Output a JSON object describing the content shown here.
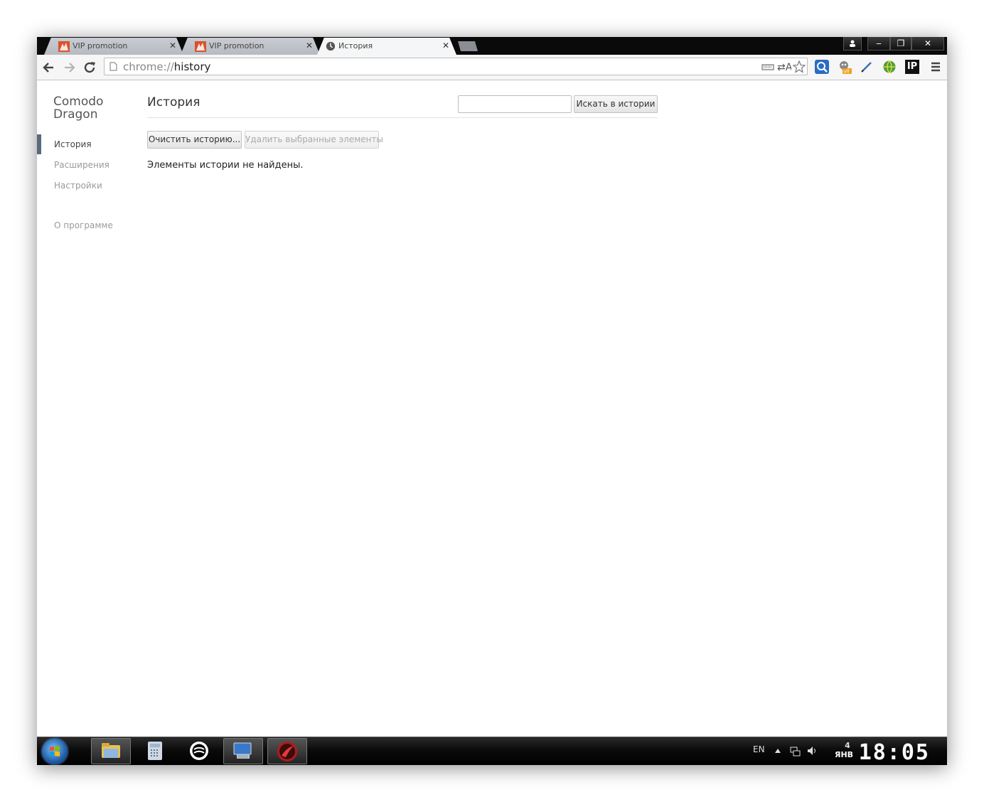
{
  "tabs": [
    {
      "title": "VIP promotion",
      "active": false,
      "icon": "vip-favicon"
    },
    {
      "title": "VIP promotion",
      "active": false,
      "icon": "vip-favicon"
    },
    {
      "title": "История",
      "active": true,
      "icon": "clock-icon"
    }
  ],
  "tab_close": "✕",
  "window_controls": {
    "minimize": "‒",
    "maximize": "❐",
    "close": "✕"
  },
  "omnibox": {
    "scheme": "chrome://",
    "host": "history"
  },
  "sidebar": {
    "brand_line1": "Comodo",
    "brand_line2": "Dragon",
    "items": [
      {
        "label": "История",
        "selected": true
      },
      {
        "label": "Расширения",
        "selected": false
      },
      {
        "label": "Настройки",
        "selected": false
      }
    ],
    "about": "О программе"
  },
  "main": {
    "title": "История",
    "search_button": "Искать в истории",
    "clear_button": "Очистить историю...",
    "delete_button": "Удалить выбранные элементы",
    "empty_message": "Элементы истории не найдены."
  },
  "extensions": {
    "ip_label": "IP",
    "off_badge": "off"
  },
  "taskbar": {
    "language": "EN",
    "date_day": "4",
    "date_month": "ЯНВ",
    "time": "18:05"
  },
  "colors": {
    "selected_bar": "#5a6a7e",
    "accent": "#e8552a"
  }
}
